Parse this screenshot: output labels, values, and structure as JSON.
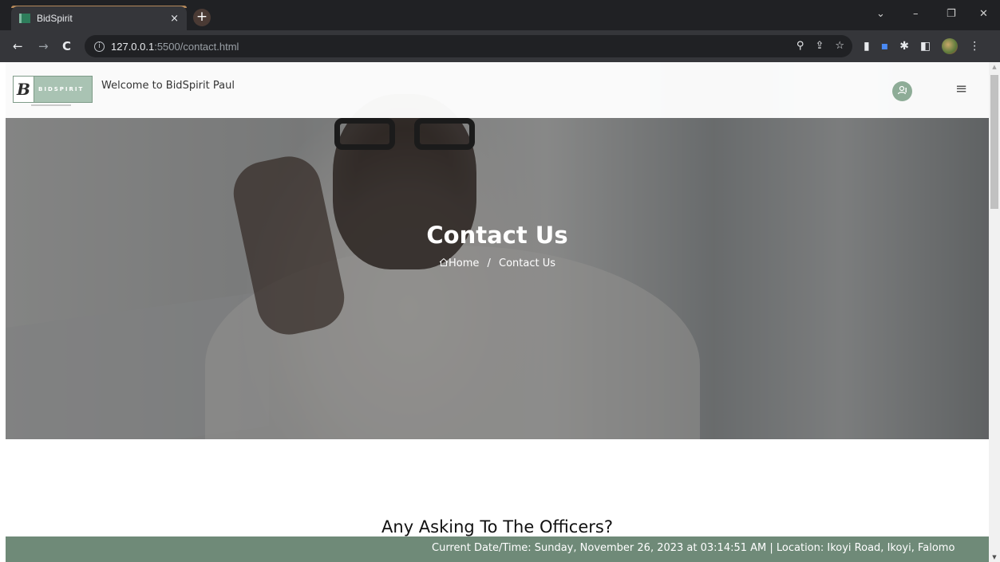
{
  "browser": {
    "tab_title": "BidSpirit",
    "tab_close": "×",
    "new_tab": "+",
    "url_host": "127.0.0.1",
    "url_rest": ":5500/contact.html",
    "window_controls": [
      "⌄",
      "–",
      "❐",
      "✕"
    ]
  },
  "header": {
    "logo_letter": "B",
    "logo_word": "BIDSPIRIT",
    "welcome_text": "Welcome to BidSpirit Paul",
    "user_icon": "user-badge-icon",
    "menu_icon": "≡"
  },
  "hero": {
    "title": "Contact Us",
    "breadcrumb_home": "Home",
    "breadcrumb_separator": "/",
    "breadcrumb_current": "Contact Us"
  },
  "section": {
    "title": "Any Asking To The Officers?"
  },
  "ticker": {
    "text": "Current Date/Time: Sunday, November 26, 2023 at 03:14:51 AM | Location: Ikoyi Road, Ikoyi, Falomo"
  },
  "colors": {
    "brand_green": "#6f8a78",
    "logo_green": "#a9c3b3",
    "chrome_dark": "#202124"
  }
}
